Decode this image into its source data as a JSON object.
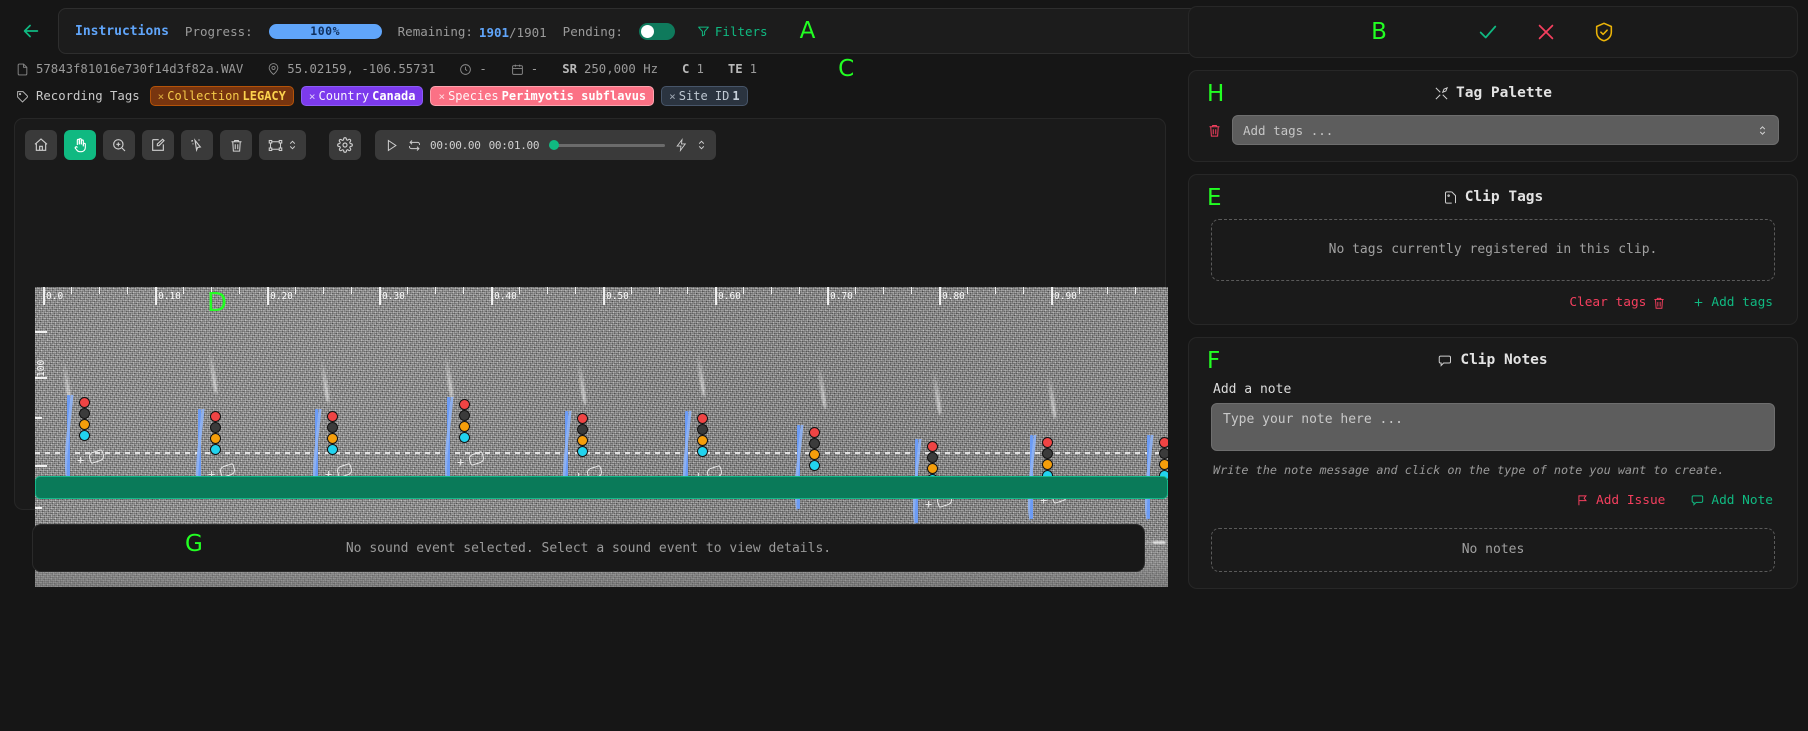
{
  "topbar": {
    "back_arrow": "←",
    "next_arrow": "→",
    "instructions_label": "Instructions",
    "progress_label": "Progress:",
    "progress_value": "100%",
    "progress_pct": 100,
    "remaining_label": "Remaining:",
    "remaining_current": "1901",
    "remaining_total": "/1901",
    "pending_label": "Pending:",
    "pending_on": true,
    "filters_label": "Filters",
    "marker_A": "A",
    "marker_B": "B",
    "marker_C": "C"
  },
  "metadata": {
    "filename": "57843f81016e730f14d3f82a.WAV",
    "coordinates": "55.02159, -106.55731",
    "time_value": "-",
    "date_value": "-",
    "sample_rate_key": "SR",
    "sample_rate_value": "250,000 Hz",
    "channels_key": "C",
    "channels_value": "1",
    "te_key": "TE",
    "te_value": "1"
  },
  "recording_tags": {
    "label": "Recording Tags",
    "tags": [
      {
        "key": "Collection",
        "value": "LEGACY",
        "color": "amber"
      },
      {
        "key": "Country",
        "value": "Canada",
        "color": "violet"
      },
      {
        "key": "Species",
        "value": "Perimyotis subflavus",
        "color": "rose"
      },
      {
        "key": "Site ID",
        "value": "1",
        "color": "slate"
      }
    ]
  },
  "toolbar": {
    "buttons": [
      {
        "name": "home-button",
        "icon": "home-icon",
        "active": false
      },
      {
        "name": "pan-button",
        "icon": "hand-icon",
        "active": true
      },
      {
        "name": "zoom-button",
        "icon": "magnifier-plus-icon",
        "active": false
      },
      {
        "name": "draw-button",
        "icon": "pencil-square-icon",
        "active": false
      },
      {
        "name": "select-button",
        "icon": "cursor-sparkle-icon",
        "active": false
      },
      {
        "name": "delete-button",
        "icon": "trash-icon",
        "active": false
      }
    ],
    "measure_button": {
      "name": "measure-button",
      "icon": "bounding-box-icon"
    },
    "settings_button": {
      "name": "settings-button",
      "icon": "gear-icon"
    }
  },
  "playback": {
    "play_icon": "play-icon",
    "loop_icon": "loop-icon",
    "current_time": "00:00.00",
    "total_time": "00:01.00",
    "lightning_icon": "lightning-icon",
    "speed_icon": "chevron-updown-icon",
    "position_pct": 0
  },
  "spectrogram": {
    "marker_D": "D",
    "time_ticks": [
      "0.0",
      "0.10",
      "0.20",
      "0.30",
      "0.40",
      "0.50",
      "0.60",
      "0.70",
      "0.80",
      "0.90"
    ],
    "freq_label": "100",
    "selection_bar_color": "#0a7a59"
  },
  "details_panel": {
    "marker_G": "G",
    "message": "No sound event selected. Select a sound event to view details."
  },
  "status": {
    "accept_icon": "check-icon",
    "reject_icon": "x-icon",
    "verify_icon": "shield-check-icon"
  },
  "tag_palette": {
    "marker_H": "H",
    "title": "Tag Palette",
    "title_icon": "tools-icon",
    "clear_icon": "trash-icon",
    "select_placeholder": "Add tags ...",
    "chevron_icon": "chevron-updown-icon"
  },
  "clip_tags": {
    "marker_E": "E",
    "title": "Clip Tags",
    "title_icon": "tag-page-icon",
    "empty_message": "No tags currently registered in this clip.",
    "clear_label": "Clear tags",
    "clear_icon": "trash-icon",
    "add_label": "Add tags",
    "add_icon": "plus-icon"
  },
  "clip_notes": {
    "marker_F": "F",
    "title": "Clip Notes",
    "title_icon": "note-bubble-icon",
    "add_note_label": "Add a note",
    "note_placeholder": "Type your note here ...",
    "note_value": "",
    "hint": "Write the note message and click on the type of note you want to create.",
    "add_issue_label": "Add Issue",
    "add_issue_icon": "flag-icon",
    "add_note_button_label": "Add Note",
    "add_note_icon": "note-bubble-icon",
    "empty_message": "No notes"
  },
  "colors": {
    "accent_green": "#10b981",
    "accent_blue": "#60a5fa",
    "danger": "#f43f5e",
    "amber": "#fcd34d",
    "marker_green": "#22ff22"
  }
}
